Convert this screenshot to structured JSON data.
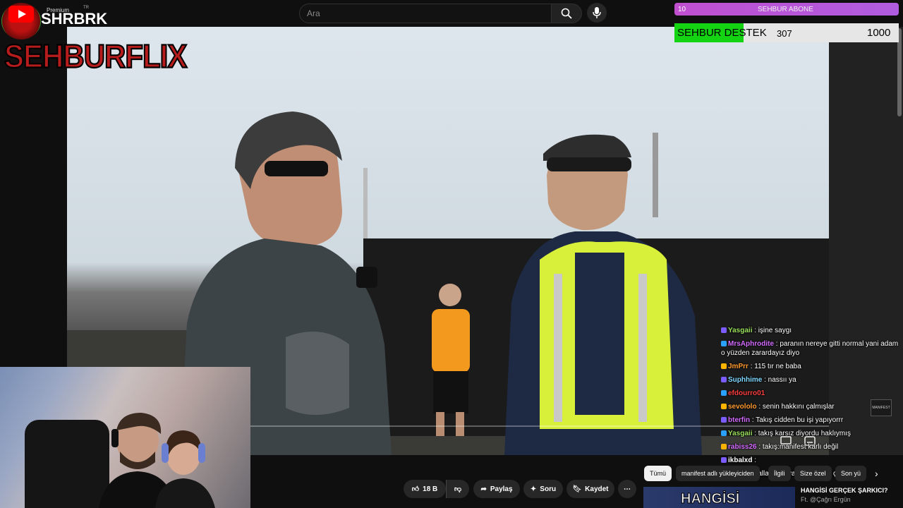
{
  "header": {
    "brand": "SHRBRK",
    "premium_label": "Premium",
    "region": "TR",
    "search_placeholder": "Ara",
    "overlay_brand": "SEHBURFLIX"
  },
  "overlays": {
    "subscriber_goal": {
      "count": "10",
      "label": "SEHBUR ABONE"
    },
    "support_goal": {
      "label": "SEHBUR DESTEK",
      "current": "307",
      "goal": "1000",
      "fill_fraction": 0.307
    }
  },
  "video": {
    "player_icons": [
      "cast-icon",
      "subtitles-icon",
      "settings-icon",
      "theater-icon",
      "fullscreen-icon"
    ],
    "watermark": "MANIFEST"
  },
  "chat": [
    {
      "user": "Yasgaii",
      "color": "#9be15d",
      "text": ": işine saygı"
    },
    {
      "user": "MrsAphrodite",
      "color": "#d36cff",
      "text": ": paranın nereye gitti normal yani adam o yüzden zarardayız diyo"
    },
    {
      "user": "JmPrr",
      "color": "#ff9b2f",
      "text": ": 115 tır ne baba"
    },
    {
      "user": "Suphhime",
      "color": "#7fd6ff",
      "text": ": nassıı ya"
    },
    {
      "user": "efdourro01",
      "color": "#ff4040",
      "text": ""
    },
    {
      "user": "sevololo",
      "color": "#ff9b2f",
      "text": ": senin hakkını çalmışlar"
    },
    {
      "user": "bterfin",
      "color": "#d36cff",
      "text": ": Takış cidden bu işi yapıyorrr"
    },
    {
      "user": "Yasgaii",
      "color": "#9be15d",
      "text": ": takış karsız diyordu haklıymış"
    },
    {
      "user": "rabiss26",
      "color": "#d36cff",
      "text": ": takış:manifest karlı değil"
    },
    {
      "user": "ikbalxd",
      "color": "#ffffff",
      "text": ":"
    },
    {
      "user": "JmPrr",
      "color": "#ff9b2f",
      "text": ": valla oyun yayınları biteli çok oldu"
    }
  ],
  "actions": {
    "likes": "18 B",
    "share": "Paylaş",
    "ask": "Soru",
    "save": "Kaydet"
  },
  "chips": [
    "Tümü",
    "manifest adlı yükleyiciden",
    "İlgili",
    "Size özel",
    "Son yü"
  ],
  "recommendation": {
    "thumb_text": "HANGİSİ",
    "title": "HANGİSİ GERÇEK ŞARKICI?",
    "artist": "Ft. @Çağrı Ergün"
  }
}
